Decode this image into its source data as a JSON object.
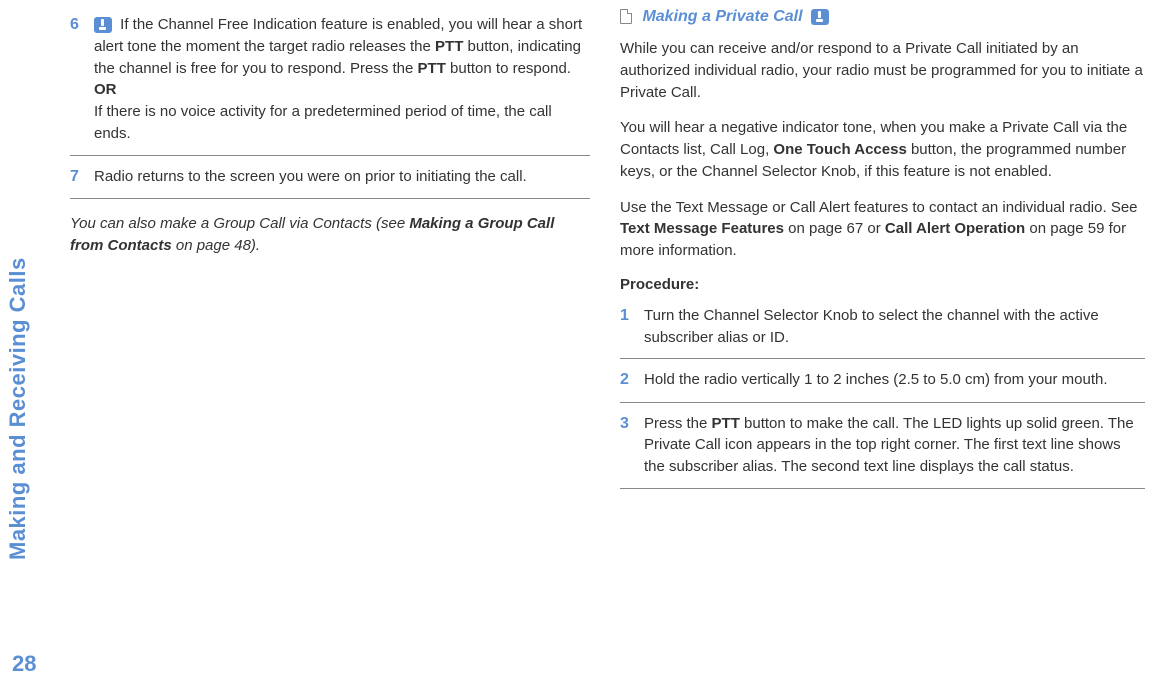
{
  "side_tab": "Making and Receiving Calls",
  "page_number": "28",
  "left_col": {
    "step6": {
      "num": "6",
      "text_before_ptt": "If the Channel Free Indication feature is enabled, you will hear a short alert tone the moment the target radio releases the ",
      "ptt1": "PTT",
      "text_mid": " button, indicating the channel is free for you to respond. Press the ",
      "ptt2": "PTT",
      "text_after": " button to respond.",
      "or_label": "OR",
      "or_text": "If there is no voice activity for a predetermined period of time, the call ends."
    },
    "step7": {
      "num": "7",
      "text": "Radio returns to the screen you were on prior to initiating the call."
    },
    "note": {
      "text_before": "You can also make a Group Call via Contacts (see ",
      "bold": "Making a Group Call from Contacts",
      "text_after": " on page 48)."
    }
  },
  "right_col": {
    "section_title": "Making a Private Call",
    "para1": "While you can receive and/or respond to a Private Call initiated by an authorized individual radio, your radio must be programmed for you to initiate a Private Call.",
    "para2": {
      "before": "You will hear a negative indicator tone, when you make a Private Call via the Contacts list, Call Log, ",
      "bold": "One Touch Access",
      "after": " button, the programmed number keys, or the Channel Selector Knob, if this feature is not enabled."
    },
    "para3": {
      "before": "Use the Text Message or Call Alert features to contact an individual radio. See ",
      "bold1": "Text Message Features",
      "mid": " on page 67 or ",
      "bold2": "Call Alert Operation",
      "after": " on page 59 for more information."
    },
    "procedure_label": "Procedure:",
    "step1": {
      "num": "1",
      "text": "Turn the Channel Selector Knob to select the channel with the active subscriber alias or ID."
    },
    "step2": {
      "num": "2",
      "text": "Hold the radio vertically 1 to 2 inches (2.5 to 5.0 cm) from your mouth."
    },
    "step3": {
      "num": "3",
      "before": "Press the ",
      "bold": "PTT",
      "after": " button to make the call. The LED lights up solid green. The Private Call icon appears in the top right corner. The first text line shows the subscriber alias. The second text line displays the call status."
    }
  }
}
